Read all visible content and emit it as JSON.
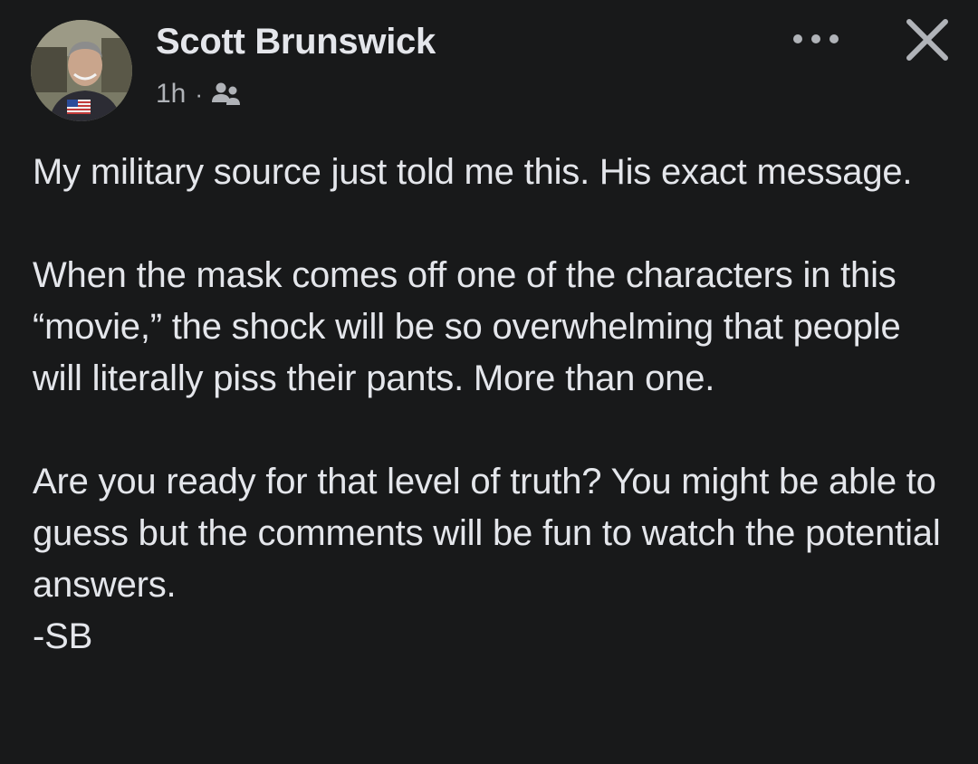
{
  "post": {
    "author_name": "Scott Brunswick",
    "timestamp": "1h",
    "separator": "·",
    "audience_icon": "friends-icon",
    "avatar_icon": "profile-photo-with-flag",
    "more_icon": "ellipsis-icon",
    "close_icon": "close-icon",
    "paragraphs": [
      "My military source just told me this. His exact message.",
      "When the mask comes off one of the characters in this “movie,” the shock will be so overwhelming that people will literally piss their pants. More than one.",
      "Are you ready for that level of truth? You might be able to guess but the comments will be fun to watch the potential answers.\n-SB"
    ]
  },
  "colors": {
    "background": "#18191a",
    "primary_text": "#e4e6eb",
    "secondary_text": "#b0b3b8"
  }
}
